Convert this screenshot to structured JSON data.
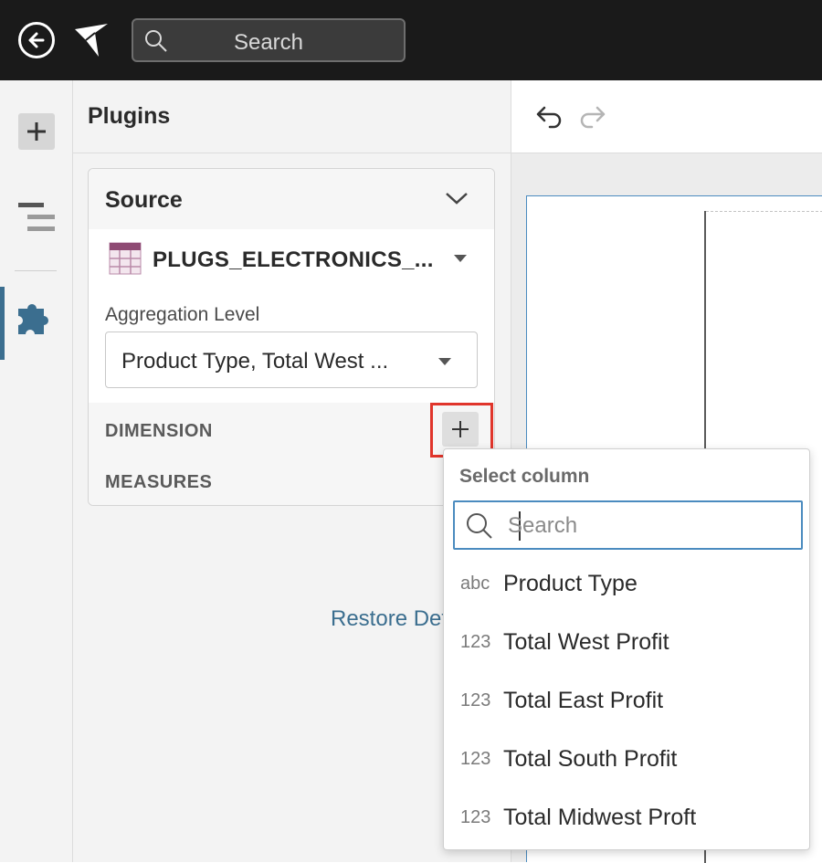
{
  "topbar": {
    "search_placeholder": "Search"
  },
  "panel": {
    "title": "Plugins",
    "source": {
      "title": "Source",
      "table_name": "PLUGS_ELECTRONICS_..."
    },
    "aggregation": {
      "label": "Aggregation Level",
      "value": "Product Type, Total West ..."
    },
    "dimension_label": "DIMENSION",
    "measures_label": "MEASURES",
    "restore_label": "Restore Default Va"
  },
  "dropdown": {
    "title": "Select column",
    "search_placeholder": "Search",
    "items": [
      {
        "type": "abc",
        "name": "Product Type"
      },
      {
        "type": "123",
        "name": "Total West Profit"
      },
      {
        "type": "123",
        "name": "Total East Profit"
      },
      {
        "type": "123",
        "name": "Total South Profit"
      },
      {
        "type": "123",
        "name": "Total Midwest Proft"
      }
    ]
  },
  "colors": {
    "accent": "#3b6e8f",
    "focus_border": "#4b8bbf",
    "highlight_frame": "#e0352b",
    "table_icon": "#8e4a73"
  }
}
